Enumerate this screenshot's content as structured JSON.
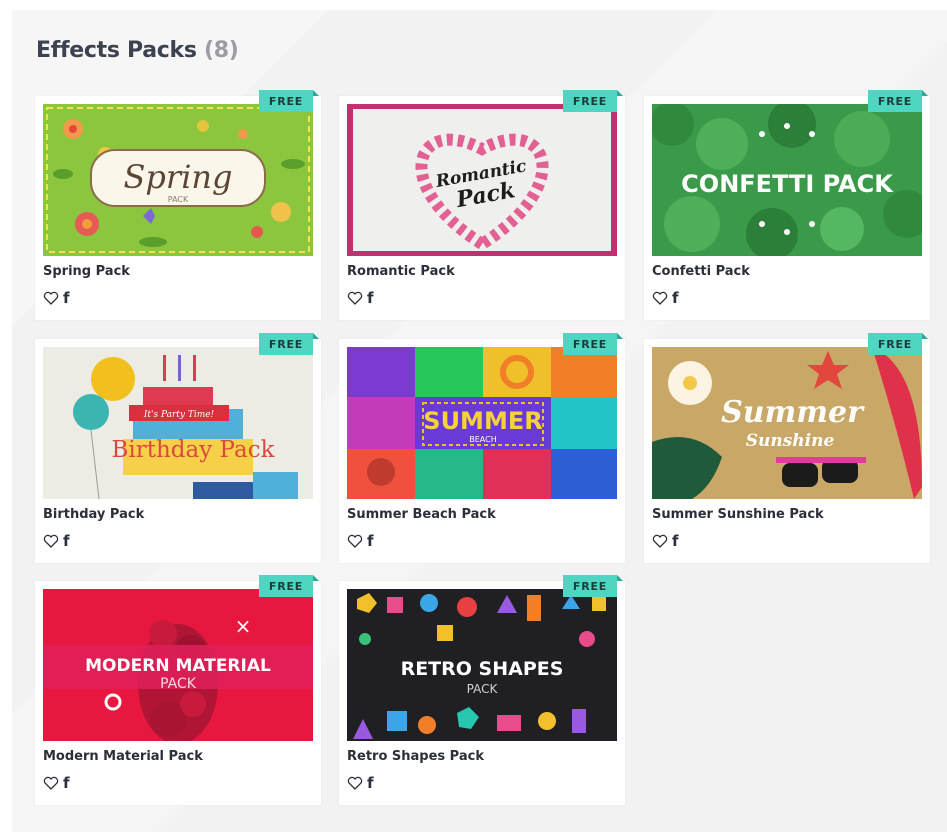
{
  "section": {
    "title": "Effects Packs",
    "count": "(8)"
  },
  "cards": [
    {
      "title": "Spring Pack",
      "badge": "FREE",
      "thumb_text": "Spring",
      "thumb_sub": "PACK"
    },
    {
      "title": "Romantic Pack",
      "badge": "FREE",
      "thumb_text": "Romantic",
      "thumb_sub": "Pack"
    },
    {
      "title": "Confetti Pack",
      "badge": "FREE",
      "thumb_text": "CONFETTI PACK"
    },
    {
      "title": "Birthday Pack",
      "badge": "FREE",
      "thumb_text": "Birthday Pack",
      "thumb_sub": "It's Party Time!"
    },
    {
      "title": "Summer Beach Pack",
      "badge": "FREE",
      "thumb_text": "SUMMER",
      "thumb_sub": "BEACH"
    },
    {
      "title": "Summer Sunshine Pack",
      "badge": "FREE",
      "thumb_text": "Summer",
      "thumb_sub": "Sunshine"
    },
    {
      "title": "Modern Material Pack",
      "badge": "FREE",
      "thumb_text": "MODERN MATERIAL",
      "thumb_sub": "PACK"
    },
    {
      "title": "Retro Shapes Pack",
      "badge": "FREE",
      "thumb_text": "RETRO SHAPES",
      "thumb_sub": "PACK"
    }
  ],
  "icons": {
    "like": "heart-outline-icon",
    "share": "facebook-icon"
  },
  "colors": {
    "badge": "#4fd6c3",
    "title": "#3d4250",
    "count": "#9a9da3",
    "panel": "#f2f2f2"
  }
}
